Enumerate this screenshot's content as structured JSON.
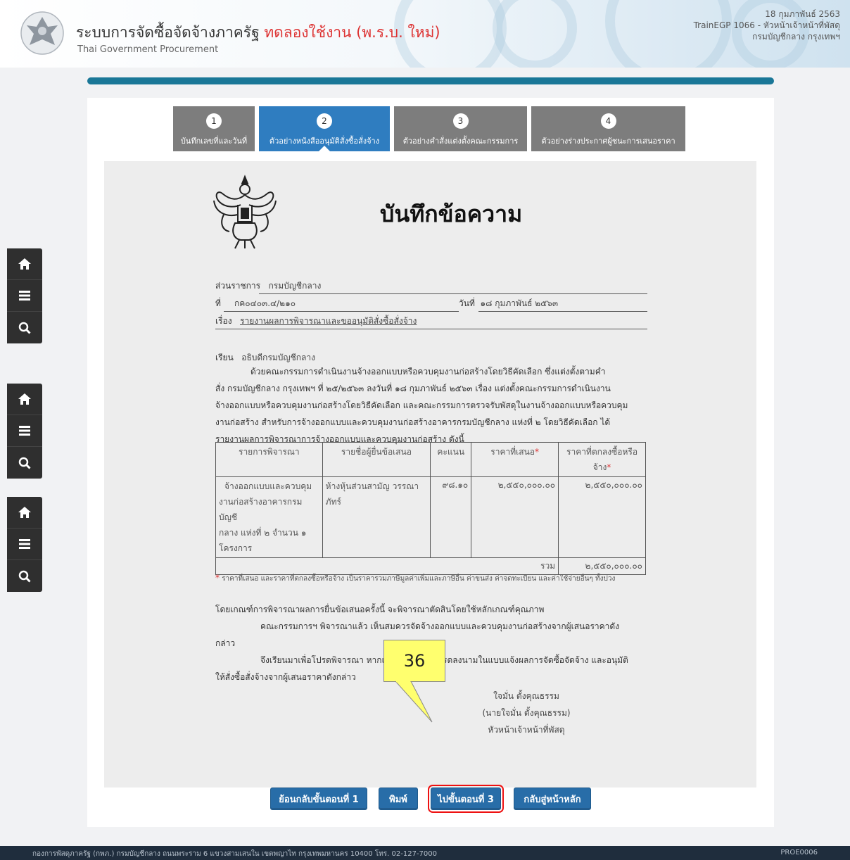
{
  "header": {
    "title": "ระบบการจัดซื้อจัดจ้างภาครัฐ",
    "trial": "ทดลองใช้งาน (พ.ร.บ. ใหม่)",
    "subtitle": "Thai Government Procurement",
    "date": "18 กุมภาพันธ์ 2563",
    "user": "TrainEGP 1066 - หัวหน้าเจ้าหน้าที่พัสดุ",
    "org": "กรมบัญชีกลาง กรุงเทพฯ"
  },
  "sidenav": {
    "icons": [
      "home-icon",
      "menu-icon",
      "search-icon"
    ]
  },
  "steps": [
    {
      "num": "1",
      "label": "บันทึกเลขที่และวันที่",
      "active": false
    },
    {
      "num": "2",
      "label": "ตัวอย่างหนังสืออนุมัติสั่งซื้อสั่งจ้าง",
      "active": true
    },
    {
      "num": "3",
      "label": "ตัวอย่างคำสั่งแต่งตั้งคณะกรรมการ",
      "active": false
    },
    {
      "num": "4",
      "label": "ตัวอย่างร่างประกาศผู้ชนะการเสนอราคา",
      "active": false
    }
  ],
  "memo": {
    "title": "บันทึกข้อความ",
    "agency_label": "ส่วนราชการ",
    "agency": "กรมบัญชีกลาง",
    "no_label": "ที่",
    "no": "กค๐๔๐๓.๔/๒๑๐",
    "date_label": "วันที่",
    "date": "๑๘ กุมภาพันธ์ ๒๕๖๓",
    "subject_label": "เรื่อง",
    "subject": "รายงานผลการพิจารณาและขออนุมัติสั่งซื้อสั่งจ้าง",
    "to_label": "เรียน",
    "to": "อธิบดีกรมบัญชีกลาง",
    "para1": [
      "ด้วยคณะกรรมการดำเนินงานจ้างออกแบบหรือควบคุมงานก่อสร้างโดยวิธีคัดเลือก ซึ่งแต่งตั้งตามคำ",
      "สั่ง กรมบัญชีกลาง กรุงเทพฯ ที่ ๒๕/๒๕๖๓ ลงวันที่ ๑๘ กุมภาพันธ์ ๒๕๖๓ เรื่อง แต่งตั้งคณะกรรมการดำเนินงาน",
      "จ้างออกแบบหรือควบคุมงานก่อสร้างโดยวิธีคัดเลือก และคณะกรรมการตรวจรับพัสดุในงานจ้างออกแบบหรือควบคุม",
      "งานก่อสร้าง สำหรับการจ้างออกแบบและควบคุมงานก่อสร้างอาคารกรมบัญชีกลาง แห่งที่ ๒ โดยวิธีคัดเลือก ได้",
      "รายงานผลการพิจารณาการจ้างออกแบบและควบคุมงานก่อสร้าง ดังนี้"
    ],
    "table": {
      "headers": [
        "รายการพิจารณา",
        "รายชื่อผู้ยื่นข้อเสนอ",
        "คะแนน",
        "ราคาที่เสนอ",
        "ราคาที่ตกลงซื้อหรือจ้าง"
      ],
      "row": {
        "item": [
          "จ้างออกแบบและควบคุม",
          "งานก่อสร้างอาคารกรมบัญชี",
          "กลาง แห่งที่ ๒ จำนวน ๑",
          "โครงการ"
        ],
        "bidder": [
          "ห้างหุ้นส่วนสามัญ วรรณา",
          "ภัทร์"
        ],
        "score": "๙๘.๑๐",
        "offer": "๒,๕๕๐,๐๐๐.๐๐",
        "agreed": "๒,๕๕๐,๐๐๐.๐๐"
      },
      "total_label": "รวม",
      "total": "๒,๕๕๐,๐๐๐.๐๐"
    },
    "note": "ราคาที่เสนอ และราคาที่ตกลงซื้อหรือจ้าง เป็นราคารวมภาษีมูลค่าเพิ่มและภาษีอื่น ค่าขนส่ง ค่าจดทะเบียน และค่าใช้จ่ายอื่นๆ ทั้งปวง",
    "para2": "โดยเกณฑ์การพิจารณาผลการยื่นข้อเสนอครั้งนี้ จะพิจารณาตัดสินโดยใช้หลักเกณฑ์คุณภาพ",
    "para3a": "คณะกรรมการฯ พิจารณาแล้ว เห็นสมควรจัดจ้างออกแบบและควบคุมงานก่อสร้างจากผู้เสนอราคาดัง",
    "para3b": "กล่าว",
    "para4a": "จึงเรียนมาเพื่อโปรดพิจารณา หากเห็นชอบขอได้โปรดลงนามในแบบแจ้งผลการจัดซื้อจัดจ้าง และอนุมัติ",
    "para4b": "ให้สั่งซื้อสั่งจ้างจากผู้เสนอราคาดังกล่าว",
    "sign_name": "ใจมั่น ตั้งคุณธรรม",
    "sign_full": "(นายใจมั่น ตั้งคุณธรรม)",
    "sign_pos": "หัวหน้าเจ้าหน้าที่พัสดุ"
  },
  "callout": "36",
  "buttons": {
    "back": "ย้อนกลับขั้นตอนที่ 1",
    "print": "พิมพ์",
    "next": "ไปขั้นตอนที่ 3",
    "home": "กลับสู่หน้าหลัก"
  },
  "footer": {
    "text": "กองการพัสดุภาครัฐ (กพภ.) กรมบัญชีกลาง ถนนพระราม 6 แขวงสามเสนใน เขตพญาไท กรุงเทพมหานคร 10400 โทร. 02-127-7000",
    "code": "PROE0006"
  },
  "colors": {
    "accent": "#2f7dc0",
    "bar": "#1a7797",
    "footer": "#1f2d3d",
    "highlight": "#e11111",
    "callout": "#ffff6e"
  }
}
